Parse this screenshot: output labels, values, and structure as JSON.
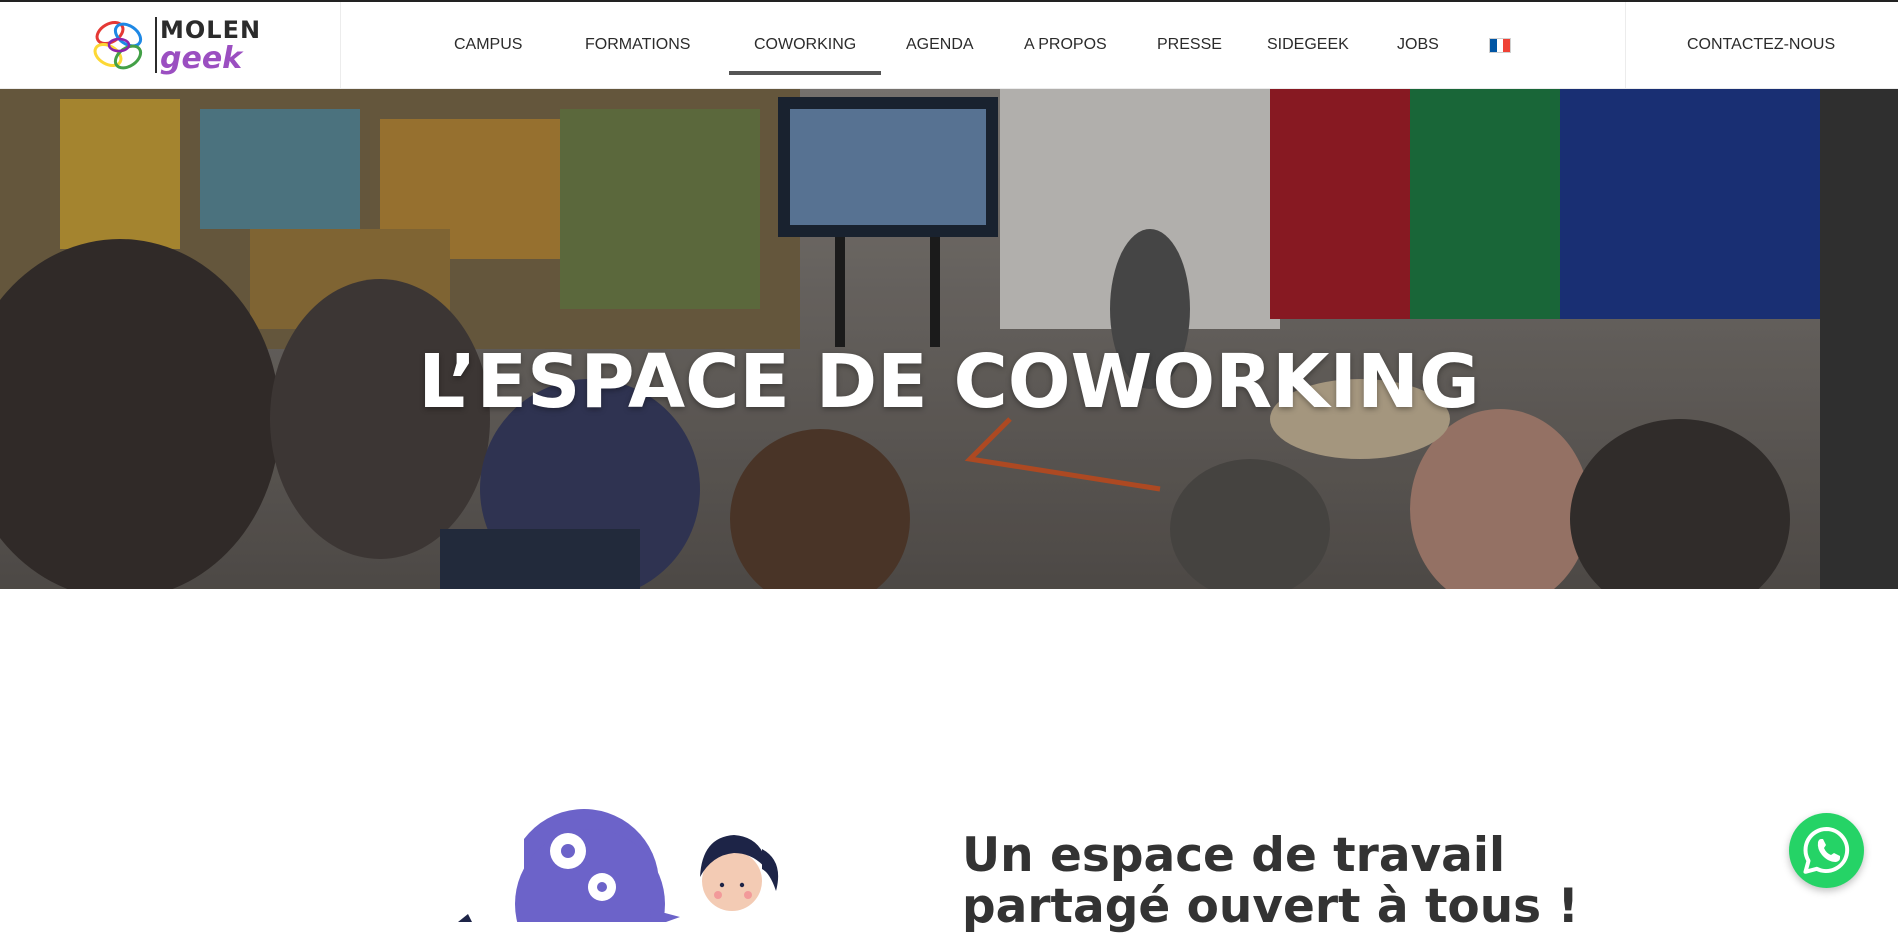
{
  "brand": {
    "logo_word_1": "MOLEN",
    "logo_word_2": "geek"
  },
  "nav": {
    "items": [
      {
        "label": "CAMPUS"
      },
      {
        "label": "FORMATIONS"
      },
      {
        "label": "COWORKING",
        "active": true
      },
      {
        "label": "AGENDA"
      },
      {
        "label": "A PROPOS"
      },
      {
        "label": "PRESSE"
      },
      {
        "label": "SIDEGEEK"
      },
      {
        "label": "JOBS"
      }
    ],
    "language_flag": "fr-flag-icon",
    "contact_label": "CONTACTEZ-NOUS"
  },
  "hero": {
    "title": "L’ESPACE DE COWORKING"
  },
  "section": {
    "title_line_1": "Un espace de travail",
    "title_line_2": "partagé ouvert à tous !"
  },
  "colors": {
    "accent_purple": "#6c63c9",
    "logo_purple": "#9b4fc1",
    "whatsapp_green": "#25d366",
    "active_underline": "#555555",
    "flag_blue": "#0055a4",
    "flag_red": "#ef4135"
  },
  "widgets": {
    "chat_icon": "whatsapp-icon"
  }
}
